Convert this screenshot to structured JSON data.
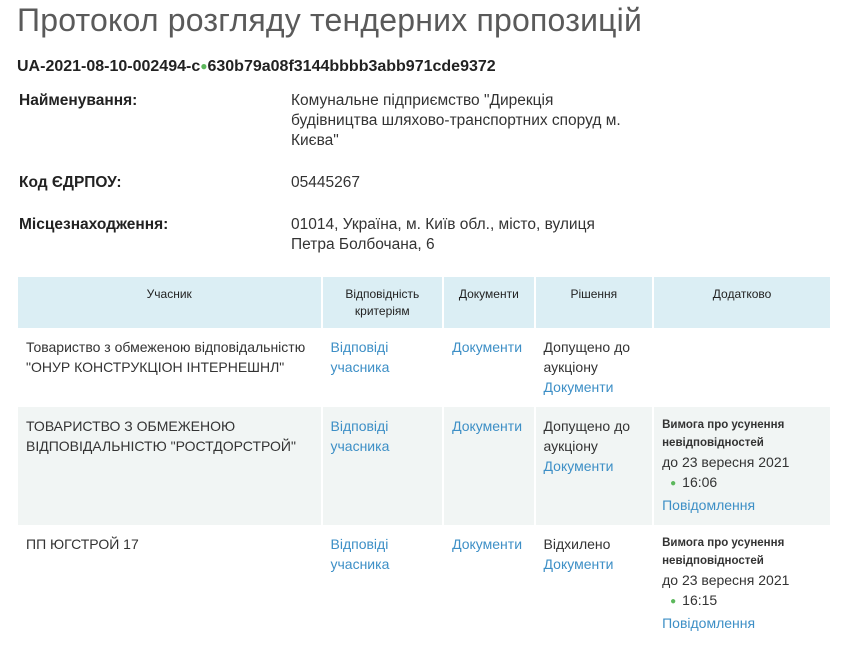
{
  "page": {
    "title": "Протокол розгляду тендерних пропозицій",
    "tender_id_prefix": "UA-2021-08-10-002494-c",
    "tender_id_dot": "●",
    "tender_id_suffix": "630b79a08f3144bbbb3abb971cde9372"
  },
  "info": [
    {
      "label": "Найменування:",
      "value": "Комунальне підприємство \"Дирекція будівництва шляхово-транспортних споруд м. Києва\""
    },
    {
      "label": "Код ЄДРПОУ:",
      "value": "05445267"
    },
    {
      "label": "Місцезнаходження:",
      "value": "01014, Україна, м. Київ обл., місто, вулиця Петра Болбочана, 6"
    }
  ],
  "table": {
    "headers": [
      "Учасник",
      "Відповідність критеріям",
      "Документи",
      "Рішення",
      "Додатково"
    ],
    "rows": [
      {
        "participant": "Товариство з обмеженою відповідальністю \"ОНУР КОНСТРУКЦІОН ІНТЕРНЕШНЛ\"",
        "criteria_link": "Відповіді учасника",
        "docs_link": "Документи",
        "decision": "Допущено до аукціону",
        "decision_link": "Документи",
        "extra_head": "",
        "extra_date": "",
        "extra_time": "",
        "extra_link": ""
      },
      {
        "participant": "ТОВАРИСТВО З ОБМЕЖЕНОЮ ВІДПОВІДАЛЬНІСТЮ \"РОСТДОРСТРОЙ\"",
        "criteria_link": "Відповіді учасника",
        "docs_link": "Документи",
        "decision": "Допущено до аукціону",
        "decision_link": "Документи",
        "extra_head": "Вимога про усунення невідповідностей",
        "extra_date": "до 23 вересня 2021",
        "extra_time": "16:06",
        "extra_link": "Повідомлення"
      },
      {
        "participant": "ПП ЮГСТРОЙ 17",
        "criteria_link": "Відповіді учасника",
        "docs_link": "Документи",
        "decision": "Відхилено",
        "decision_link": "Документи",
        "extra_head": "Вимога про усунення невідповідностей",
        "extra_date": "до 23 вересня 2021",
        "extra_time": "16:15",
        "extra_link": "Повідомлення"
      }
    ]
  },
  "colors": {
    "header_bg": "#dbeef4",
    "link": "#3d8fc6",
    "alt_row_bg": "#f1f5f4",
    "bullet": "#5cb85c"
  }
}
